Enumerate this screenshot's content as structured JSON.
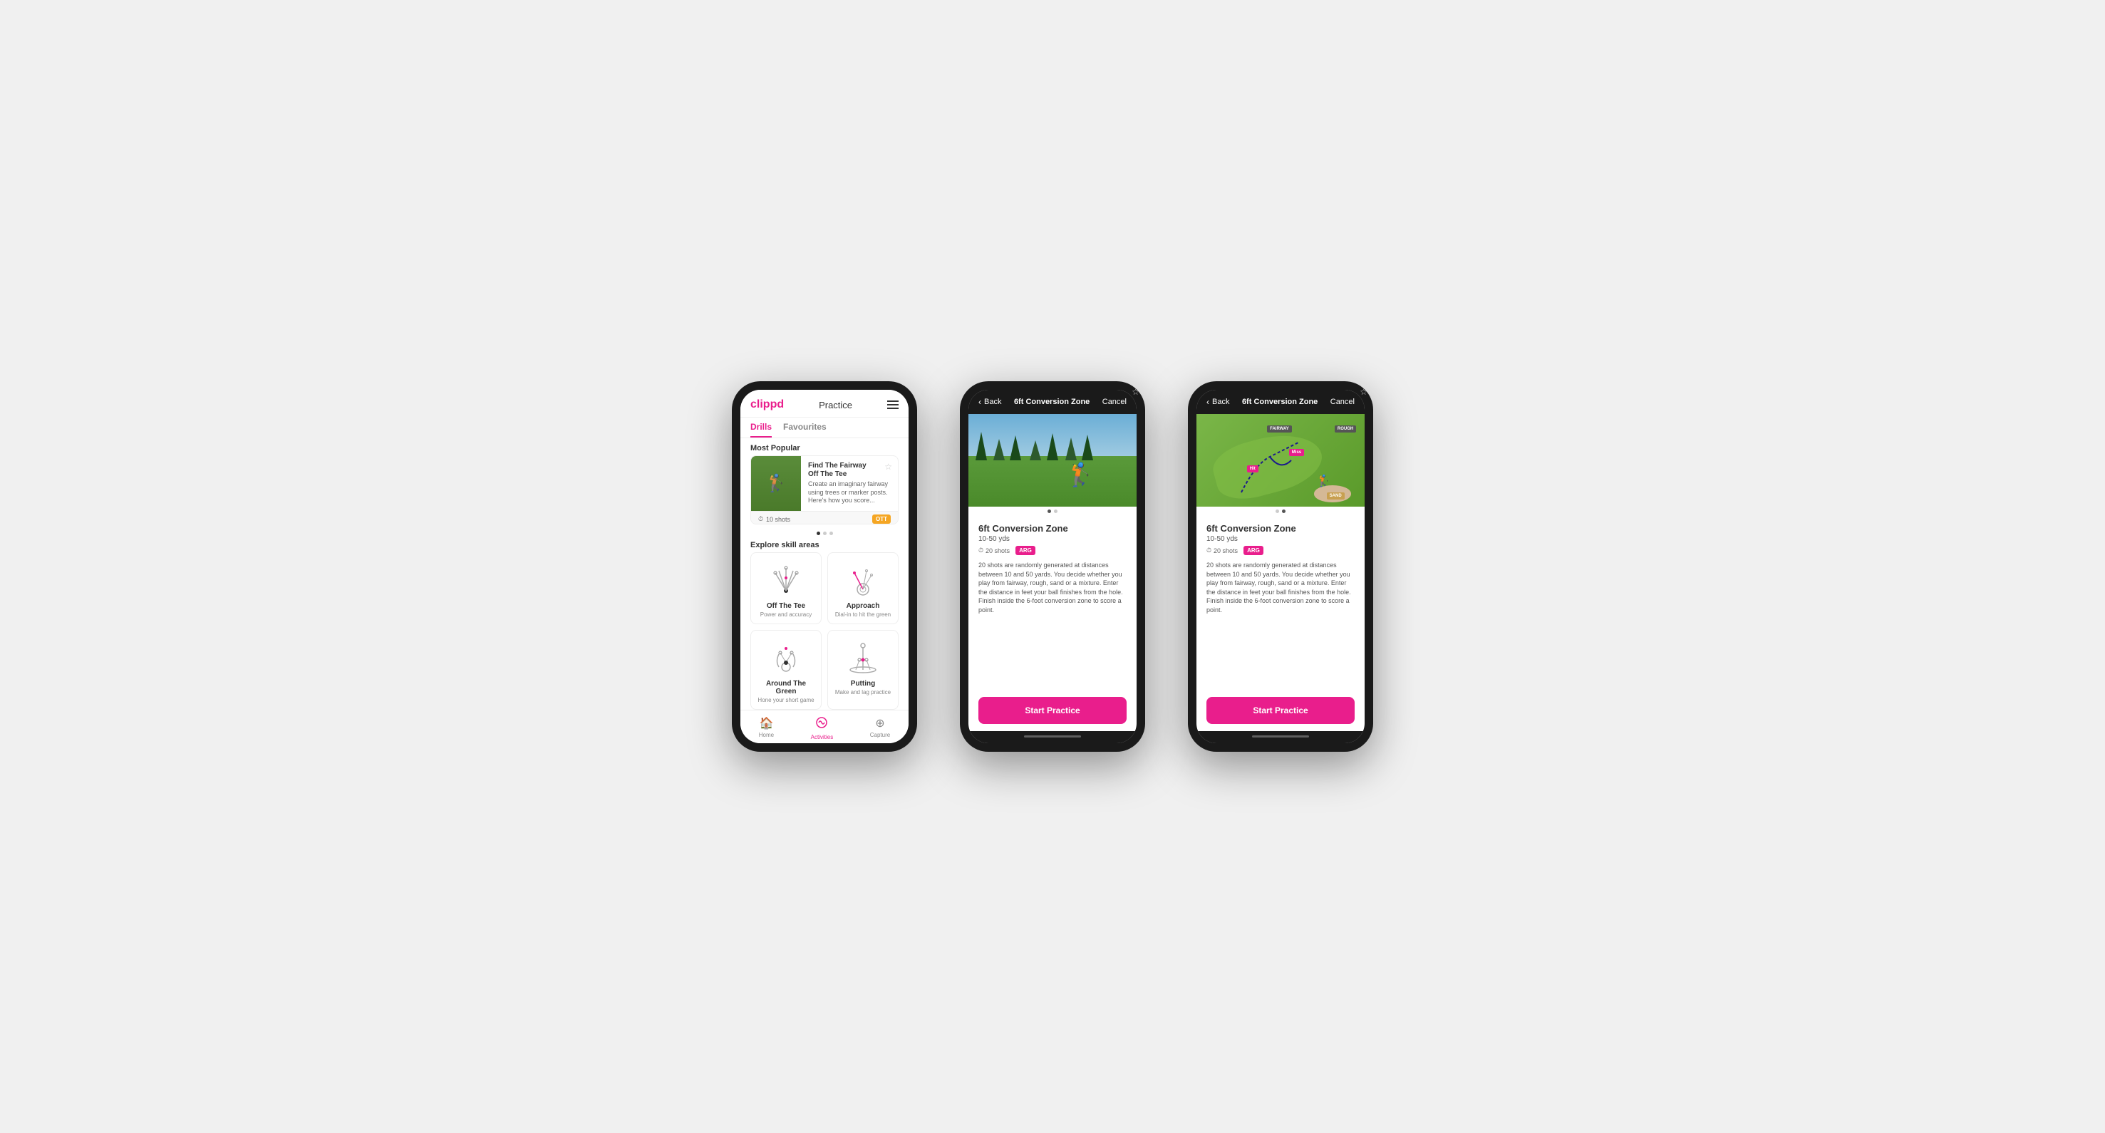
{
  "phones": {
    "phone1": {
      "header": {
        "logo": "clippd",
        "title": "Practice",
        "menu_icon": "hamburger"
      },
      "tabs": [
        {
          "label": "Drills",
          "active": true
        },
        {
          "label": "Favourites",
          "active": false
        }
      ],
      "most_popular_label": "Most Popular",
      "featured_drill": {
        "title": "Find The Fairway",
        "subtitle": "Off The Tee",
        "description": "Create an imaginary fairway using trees or marker posts. Here's how you score...",
        "shots": "10 shots",
        "tag": "OTT"
      },
      "pagination_dots": 3,
      "explore_label": "Explore skill areas",
      "skills": [
        {
          "name": "Off The Tee",
          "description": "Power and accuracy",
          "icon": "ott"
        },
        {
          "name": "Approach",
          "description": "Dial-in to hit the green",
          "icon": "approach"
        },
        {
          "name": "Around The Green",
          "description": "Hone your short game",
          "icon": "atg"
        },
        {
          "name": "Putting",
          "description": "Make and lag practice",
          "icon": "putting"
        }
      ],
      "nav": [
        {
          "label": "Home",
          "icon": "🏠",
          "active": false
        },
        {
          "label": "Activities",
          "icon": "♻",
          "active": true
        },
        {
          "label": "Capture",
          "icon": "⊕",
          "active": false
        }
      ]
    },
    "phone2": {
      "header": {
        "back_label": "Back",
        "title": "6ft Conversion Zone",
        "cancel_label": "Cancel"
      },
      "image_type": "photo",
      "drill": {
        "title": "6ft Conversion Zone",
        "range": "10-50 yds",
        "shots": "20 shots",
        "tag": "ARG",
        "description": "20 shots are randomly generated at distances between 10 and 50 yards. You decide whether you play from fairway, rough, sand or a mixture. Enter the distance in feet your ball finishes from the hole. Finish inside the 6-foot conversion zone to score a point."
      },
      "start_label": "Start Practice"
    },
    "phone3": {
      "header": {
        "back_label": "Back",
        "title": "6ft Conversion Zone",
        "cancel_label": "Cancel"
      },
      "image_type": "map",
      "drill": {
        "title": "6ft Conversion Zone",
        "range": "10-50 yds",
        "shots": "20 shots",
        "tag": "ARG",
        "description": "20 shots are randomly generated at distances between 10 and 50 yards. You decide whether you play from fairway, rough, sand or a mixture. Enter the distance in feet your ball finishes from the hole. Finish inside the 6-foot conversion zone to score a point."
      },
      "map_labels": {
        "hit": "Hit",
        "miss": "Miss",
        "fairway": "FAIRWAY",
        "rough": "ROUGH",
        "sand": "SAND"
      },
      "start_label": "Start Practice"
    }
  }
}
